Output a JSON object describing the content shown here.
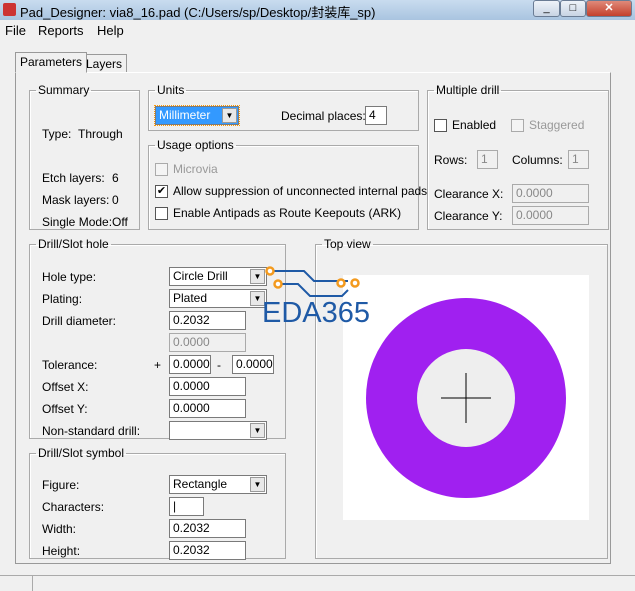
{
  "window": {
    "title": "Pad_Designer: via8_16.pad (C:/Users/sp/Desktop/封装库_sp)"
  },
  "menu": [
    "File",
    "Reports",
    "Help"
  ],
  "tabs": [
    "Parameters",
    "Layers"
  ],
  "summary": {
    "legend": "Summary",
    "type_label": "Type:",
    "type_value": "Through",
    "etch_label": "Etch layers:",
    "etch_value": "6",
    "mask_label": "Mask layers:",
    "mask_value": "0",
    "single_label": "Single Mode:",
    "single_value": "Off"
  },
  "units": {
    "legend": "Units",
    "selected": "Millimeter",
    "decimal_label": "Decimal places:",
    "decimal_value": "4"
  },
  "usage": {
    "legend": "Usage options",
    "microvia": "Microvia",
    "allow": "Allow suppression of unconnected internal pads",
    "allow_checked": true,
    "ark": "Enable Antipads as Route Keepouts (ARK)",
    "ark_checked": false
  },
  "multi": {
    "legend": "Multiple drill",
    "enabled": "Enabled",
    "staggered": "Staggered",
    "rows_label": "Rows:",
    "rows": "1",
    "cols_label": "Columns:",
    "cols": "1",
    "cx_label": "Clearance X:",
    "cx": "0.0000",
    "cy_label": "Clearance Y:",
    "cy": "0.0000"
  },
  "drill": {
    "legend": "Drill/Slot hole",
    "hole_type_label": "Hole type:",
    "hole_type": "Circle Drill",
    "plating_label": "Plating:",
    "plating": "Plated",
    "diameter_label": "Drill diameter:",
    "diameter": "0.2032",
    "diameter2": "0.0000",
    "tol_label": "Tolerance:",
    "plus": "+",
    "tol_plus": "0.0000",
    "minus": "-",
    "tol_minus": "0.0000",
    "offx_label": "Offset X:",
    "offx": "0.0000",
    "offy_label": "Offset Y:",
    "offy": "0.0000",
    "nonstd_label": "Non-standard drill:",
    "nonstd": ""
  },
  "symbol": {
    "legend": "Drill/Slot symbol",
    "figure_label": "Figure:",
    "figure": "Rectangle",
    "chars_label": "Characters:",
    "chars": "|",
    "width_label": "Width:",
    "width": "0.2032",
    "height_label": "Height:",
    "height": "0.2032"
  },
  "topview": {
    "legend": "Top view",
    "pad_color": "#a020f0",
    "hole_color": "#eeeeee"
  },
  "watermark": "EDA365"
}
